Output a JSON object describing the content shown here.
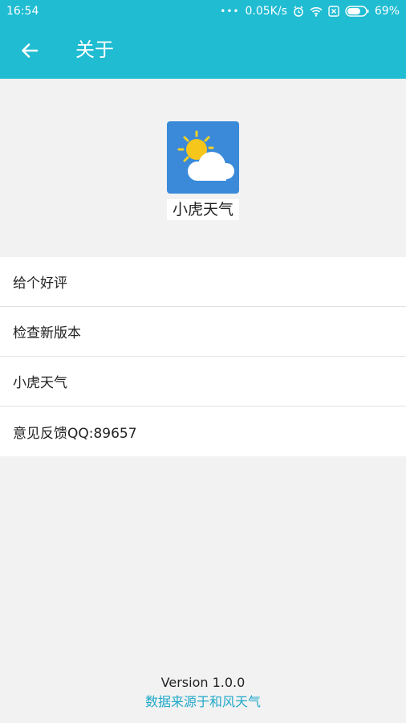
{
  "status_bar": {
    "time": "16:54",
    "net_speed": "0.05K/s",
    "battery": "69%",
    "icons": [
      "more-dots-icon",
      "alarm-icon",
      "wifi-icon",
      "sim-icon",
      "battery-icon"
    ]
  },
  "app_bar": {
    "back_icon": "arrow-left-icon",
    "title": "关于"
  },
  "logo": {
    "app_name": "小虎天气",
    "icon": "sun-cloud-icon"
  },
  "menu": {
    "items": [
      {
        "label": "给个好评"
      },
      {
        "label": "检查新版本"
      },
      {
        "label": "小虎天气"
      },
      {
        "label": "意见反馈QQ:89657"
      }
    ]
  },
  "footer": {
    "version": "Version 1.0.0",
    "source": "数据来源于和风天气"
  },
  "colors": {
    "primary": "#1fbcd2",
    "link": "#1fa8c9",
    "icon_bg": "#3a8ad9"
  }
}
